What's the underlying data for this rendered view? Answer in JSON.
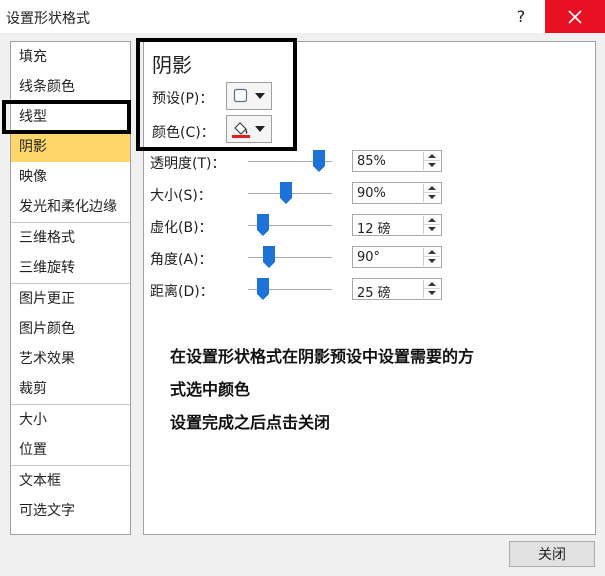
{
  "window": {
    "title": "设置形状格式",
    "help_label": "?"
  },
  "nav": {
    "groups": [
      [
        "填充",
        "线条颜色",
        "线型",
        "阴影",
        "映像",
        "发光和柔化边缘"
      ],
      [
        "三维格式",
        "三维旋转"
      ],
      [
        "图片更正",
        "图片颜色",
        "艺术效果",
        "裁剪"
      ],
      [
        "大小",
        "位置"
      ],
      [
        "文本框",
        "可选文字"
      ]
    ],
    "selected": "阴影"
  },
  "shadow": {
    "section_title": "阴影",
    "preset_label": "预设(P)：",
    "color_label": "颜色(C)：",
    "color_value": "#e0201b",
    "rows": [
      {
        "label": "透明度(T)：",
        "value": "85%",
        "fraction": 0.85
      },
      {
        "label": "大小(S)：",
        "value": "90%",
        "fraction": 0.45
      },
      {
        "label": "虚化(B)：",
        "value": "12 磅",
        "fraction": 0.18
      },
      {
        "label": "角度(A)：",
        "value": "90°",
        "fraction": 0.25
      },
      {
        "label": "距离(D)：",
        "value": "25 磅",
        "fraction": 0.18
      }
    ]
  },
  "instructions": [
    "在设置形状格式在阴影预设中设置需要的方",
    "式选中颜色",
    "设置完成之后点击关闭"
  ],
  "footer": {
    "close_label": "关闭"
  },
  "colors": {
    "slider_thumb": "#1e73d8",
    "selected_bg": "#ffd669",
    "close_x_bg": "#e81123"
  }
}
